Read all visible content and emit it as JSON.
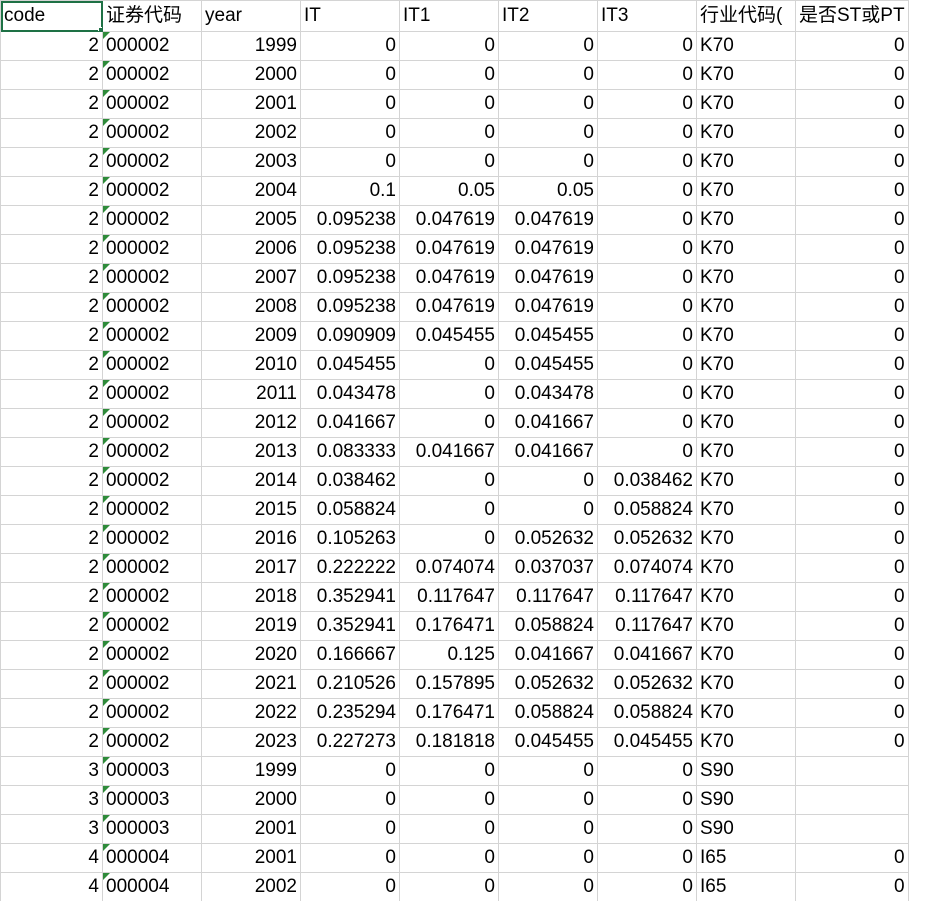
{
  "columns": [
    "code",
    "证券代码",
    "year",
    "IT",
    "IT1",
    "IT2",
    "IT3",
    "行业代码(",
    "是否ST或PT"
  ],
  "rows": [
    [
      "2",
      "000002",
      "1999",
      "0",
      "0",
      "0",
      "0",
      "K70",
      "0"
    ],
    [
      "2",
      "000002",
      "2000",
      "0",
      "0",
      "0",
      "0",
      "K70",
      "0"
    ],
    [
      "2",
      "000002",
      "2001",
      "0",
      "0",
      "0",
      "0",
      "K70",
      "0"
    ],
    [
      "2",
      "000002",
      "2002",
      "0",
      "0",
      "0",
      "0",
      "K70",
      "0"
    ],
    [
      "2",
      "000002",
      "2003",
      "0",
      "0",
      "0",
      "0",
      "K70",
      "0"
    ],
    [
      "2",
      "000002",
      "2004",
      "0.1",
      "0.05",
      "0.05",
      "0",
      "K70",
      "0"
    ],
    [
      "2",
      "000002",
      "2005",
      "0.095238",
      "0.047619",
      "0.047619",
      "0",
      "K70",
      "0"
    ],
    [
      "2",
      "000002",
      "2006",
      "0.095238",
      "0.047619",
      "0.047619",
      "0",
      "K70",
      "0"
    ],
    [
      "2",
      "000002",
      "2007",
      "0.095238",
      "0.047619",
      "0.047619",
      "0",
      "K70",
      "0"
    ],
    [
      "2",
      "000002",
      "2008",
      "0.095238",
      "0.047619",
      "0.047619",
      "0",
      "K70",
      "0"
    ],
    [
      "2",
      "000002",
      "2009",
      "0.090909",
      "0.045455",
      "0.045455",
      "0",
      "K70",
      "0"
    ],
    [
      "2",
      "000002",
      "2010",
      "0.045455",
      "0",
      "0.045455",
      "0",
      "K70",
      "0"
    ],
    [
      "2",
      "000002",
      "2011",
      "0.043478",
      "0",
      "0.043478",
      "0",
      "K70",
      "0"
    ],
    [
      "2",
      "000002",
      "2012",
      "0.041667",
      "0",
      "0.041667",
      "0",
      "K70",
      "0"
    ],
    [
      "2",
      "000002",
      "2013",
      "0.083333",
      "0.041667",
      "0.041667",
      "0",
      "K70",
      "0"
    ],
    [
      "2",
      "000002",
      "2014",
      "0.038462",
      "0",
      "0",
      "0.038462",
      "K70",
      "0"
    ],
    [
      "2",
      "000002",
      "2015",
      "0.058824",
      "0",
      "0",
      "0.058824",
      "K70",
      "0"
    ],
    [
      "2",
      "000002",
      "2016",
      "0.105263",
      "0",
      "0.052632",
      "0.052632",
      "K70",
      "0"
    ],
    [
      "2",
      "000002",
      "2017",
      "0.222222",
      "0.074074",
      "0.037037",
      "0.074074",
      "K70",
      "0"
    ],
    [
      "2",
      "000002",
      "2018",
      "0.352941",
      "0.117647",
      "0.117647",
      "0.117647",
      "K70",
      "0"
    ],
    [
      "2",
      "000002",
      "2019",
      "0.352941",
      "0.176471",
      "0.058824",
      "0.117647",
      "K70",
      "0"
    ],
    [
      "2",
      "000002",
      "2020",
      "0.166667",
      "0.125",
      "0.041667",
      "0.041667",
      "K70",
      "0"
    ],
    [
      "2",
      "000002",
      "2021",
      "0.210526",
      "0.157895",
      "0.052632",
      "0.052632",
      "K70",
      "0"
    ],
    [
      "2",
      "000002",
      "2022",
      "0.235294",
      "0.176471",
      "0.058824",
      "0.058824",
      "K70",
      "0"
    ],
    [
      "2",
      "000002",
      "2023",
      "0.227273",
      "0.181818",
      "0.045455",
      "0.045455",
      "K70",
      "0"
    ],
    [
      "3",
      "000003",
      "1999",
      "0",
      "0",
      "0",
      "0",
      "S90",
      ""
    ],
    [
      "3",
      "000003",
      "2000",
      "0",
      "0",
      "0",
      "0",
      "S90",
      ""
    ],
    [
      "3",
      "000003",
      "2001",
      "0",
      "0",
      "0",
      "0",
      "S90",
      ""
    ],
    [
      "4",
      "000004",
      "2001",
      "0",
      "0",
      "0",
      "0",
      "I65",
      "0"
    ],
    [
      "4",
      "000004",
      "2002",
      "0",
      "0",
      "0",
      "0",
      "I65",
      "0"
    ]
  ],
  "colors": {
    "selection": "#1e7145",
    "error_marker": "#2e8b3a",
    "gridline": "#d4d4d4"
  },
  "selected_cell": "code"
}
